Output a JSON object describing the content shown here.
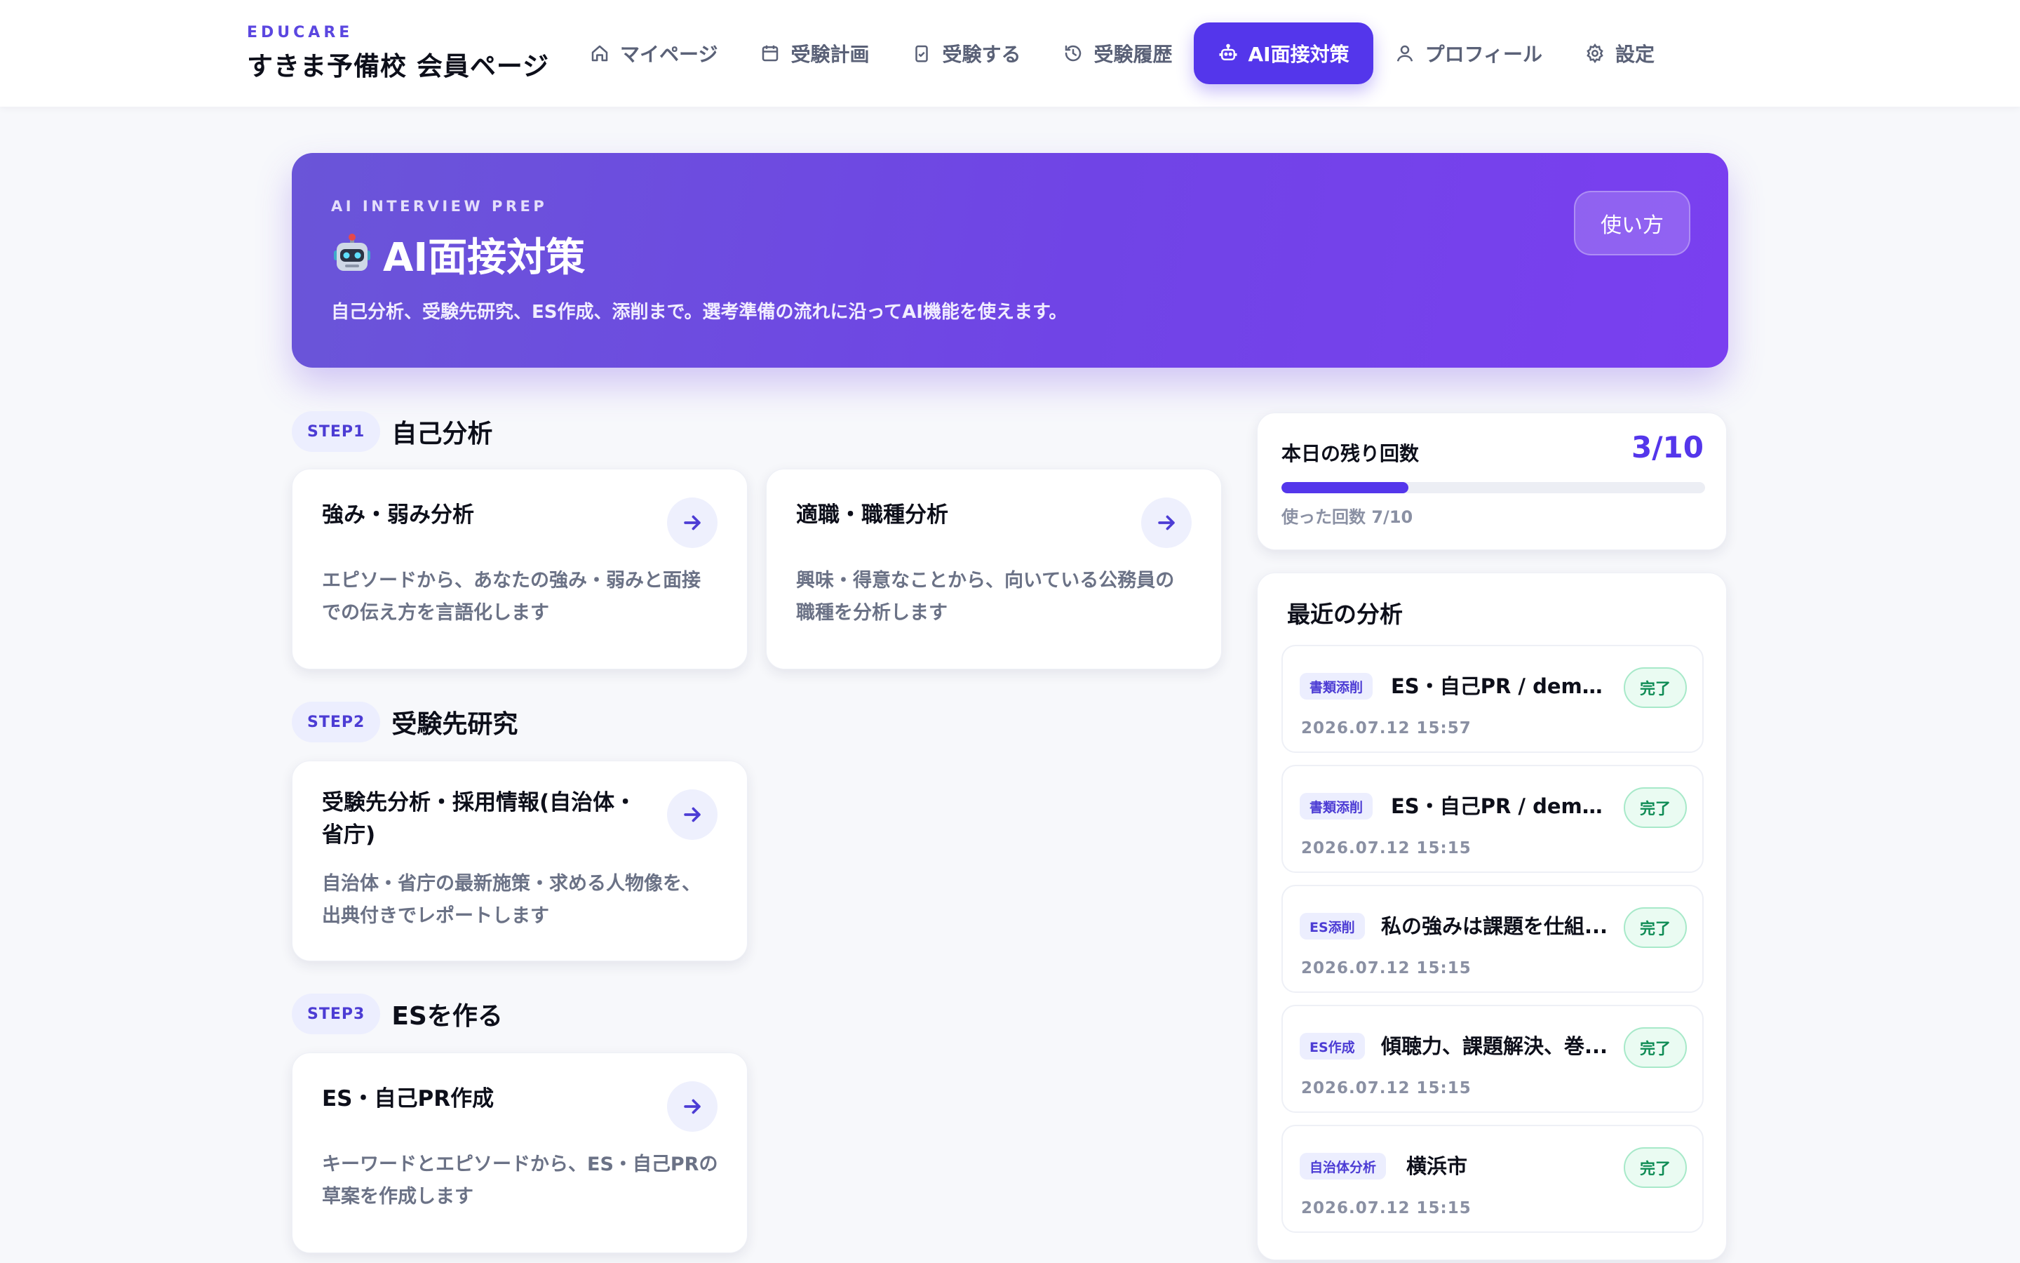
{
  "brand": {
    "tag": "EDUCARE",
    "title": "すきま予備校 会員ページ"
  },
  "nav": [
    {
      "label": "マイページ",
      "icon": "home-icon"
    },
    {
      "label": "受験計画",
      "icon": "calendar-icon"
    },
    {
      "label": "受験する",
      "icon": "clipboard-check-icon"
    },
    {
      "label": "受験履歴",
      "icon": "history-icon"
    },
    {
      "label": "AI面接対策",
      "icon": "robot-icon",
      "active": true
    },
    {
      "label": "プロフィール",
      "icon": "user-icon"
    },
    {
      "label": "設定",
      "icon": "gear-icon"
    }
  ],
  "hero": {
    "eyebrow": "AI INTERVIEW PREP",
    "title": "AI面接対策",
    "description": "自己分析、受験先研究、ES作成、添削まで。選考準備の流れに沿ってAI機能を使えます。",
    "howto_label": "使い方"
  },
  "steps": [
    {
      "badge": "STEP1",
      "title": "自己分析",
      "cards": [
        {
          "title": "強み・弱み分析",
          "desc": "エピソードから、あなたの強み・弱みと面接での伝え方を言語化します"
        },
        {
          "title": "適職・職種分析",
          "desc": "興味・得意なことから、向いている公務員の職種を分析します"
        }
      ]
    },
    {
      "badge": "STEP2",
      "title": "受験先研究",
      "cards": [
        {
          "title": "受験先分析・採用情報(自治体・省庁)",
          "desc": "自治体・省庁の最新施策・求める人物像を、出典付きでレポートします"
        }
      ]
    },
    {
      "badge": "STEP3",
      "title": "ESを作る",
      "cards": [
        {
          "title": "ES・自己PR作成",
          "desc": "キーワードとエピソードから、ES・自己PRの草案を作成します"
        }
      ]
    }
  ],
  "quota": {
    "label": "本日の残り回数",
    "count": "3/10",
    "used_text": "使った回数 7/10",
    "used_fraction": 0.3
  },
  "recent": {
    "title": "最近の分析",
    "items": [
      {
        "tag": "書類添削",
        "name": "ES・自己PR / demo...",
        "status": "完了",
        "date": "2026.07.12 15:57"
      },
      {
        "tag": "書類添削",
        "name": "ES・自己PR / demo...",
        "status": "完了",
        "date": "2026.07.12 15:15"
      },
      {
        "tag": "ES添削",
        "name": "私の強みは課題を仕組...",
        "status": "完了",
        "date": "2026.07.12 15:15"
      },
      {
        "tag": "ES作成",
        "name": "傾聴力、課題解決、巻...",
        "status": "完了",
        "date": "2026.07.12 15:15"
      },
      {
        "tag": "自治体分析",
        "name": "横浜市",
        "status": "完了",
        "date": "2026.07.12 15:15"
      }
    ]
  },
  "colors": {
    "accent": "#5436eb",
    "success": "#0f8c55",
    "muted": "#6b7286"
  }
}
